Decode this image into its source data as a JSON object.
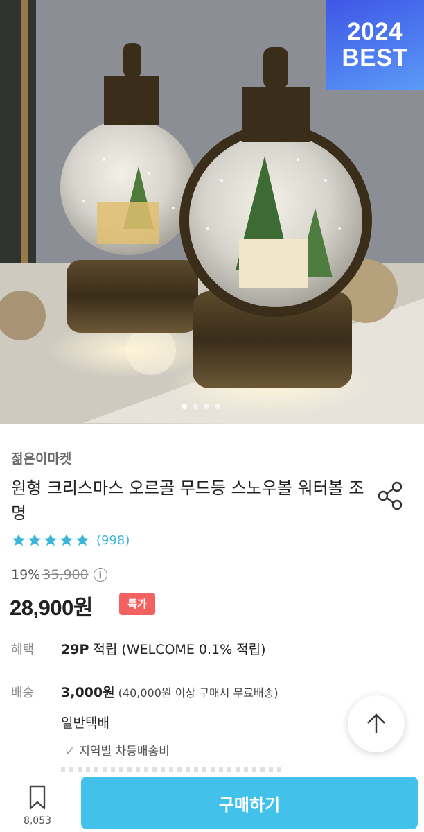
{
  "hero": {
    "badge_year": "2024",
    "badge_text": "BEST",
    "image_count": 4,
    "active_index": 0,
    "image_subject": "two lit snow-globe lanterns with Christmas trees"
  },
  "product": {
    "seller": "젊은이마켓",
    "title": "원형 크리스마스 오르골 무드등 스노우볼 워터볼 조명",
    "rating": 5,
    "review_count": "(998)",
    "discount_rate": "19%",
    "original_price": "35,900",
    "price": "28,900원",
    "special_badge": "특가"
  },
  "benefit": {
    "label": "혜택",
    "points": "29P",
    "text": " 적립 (WELCOME 0.1% 적립)"
  },
  "shipping": {
    "label": "배송",
    "fee": "3,000원",
    "condition": " (40,000원 이상 구매시 무료배송)",
    "method": "일반택배",
    "note": "지역별 차등배송비"
  },
  "bottom_bar": {
    "bookmark_count": "8,053",
    "buy_label": "구매하기"
  },
  "colors": {
    "accent": "#42c2ea",
    "star": "#3cb6d8",
    "special_badge": "#f46161",
    "best_badge": "#4d7bf0"
  },
  "icons": [
    "share-icon",
    "star-icon",
    "info-icon",
    "check-icon",
    "arrow-up-icon",
    "bookmark-icon"
  ]
}
